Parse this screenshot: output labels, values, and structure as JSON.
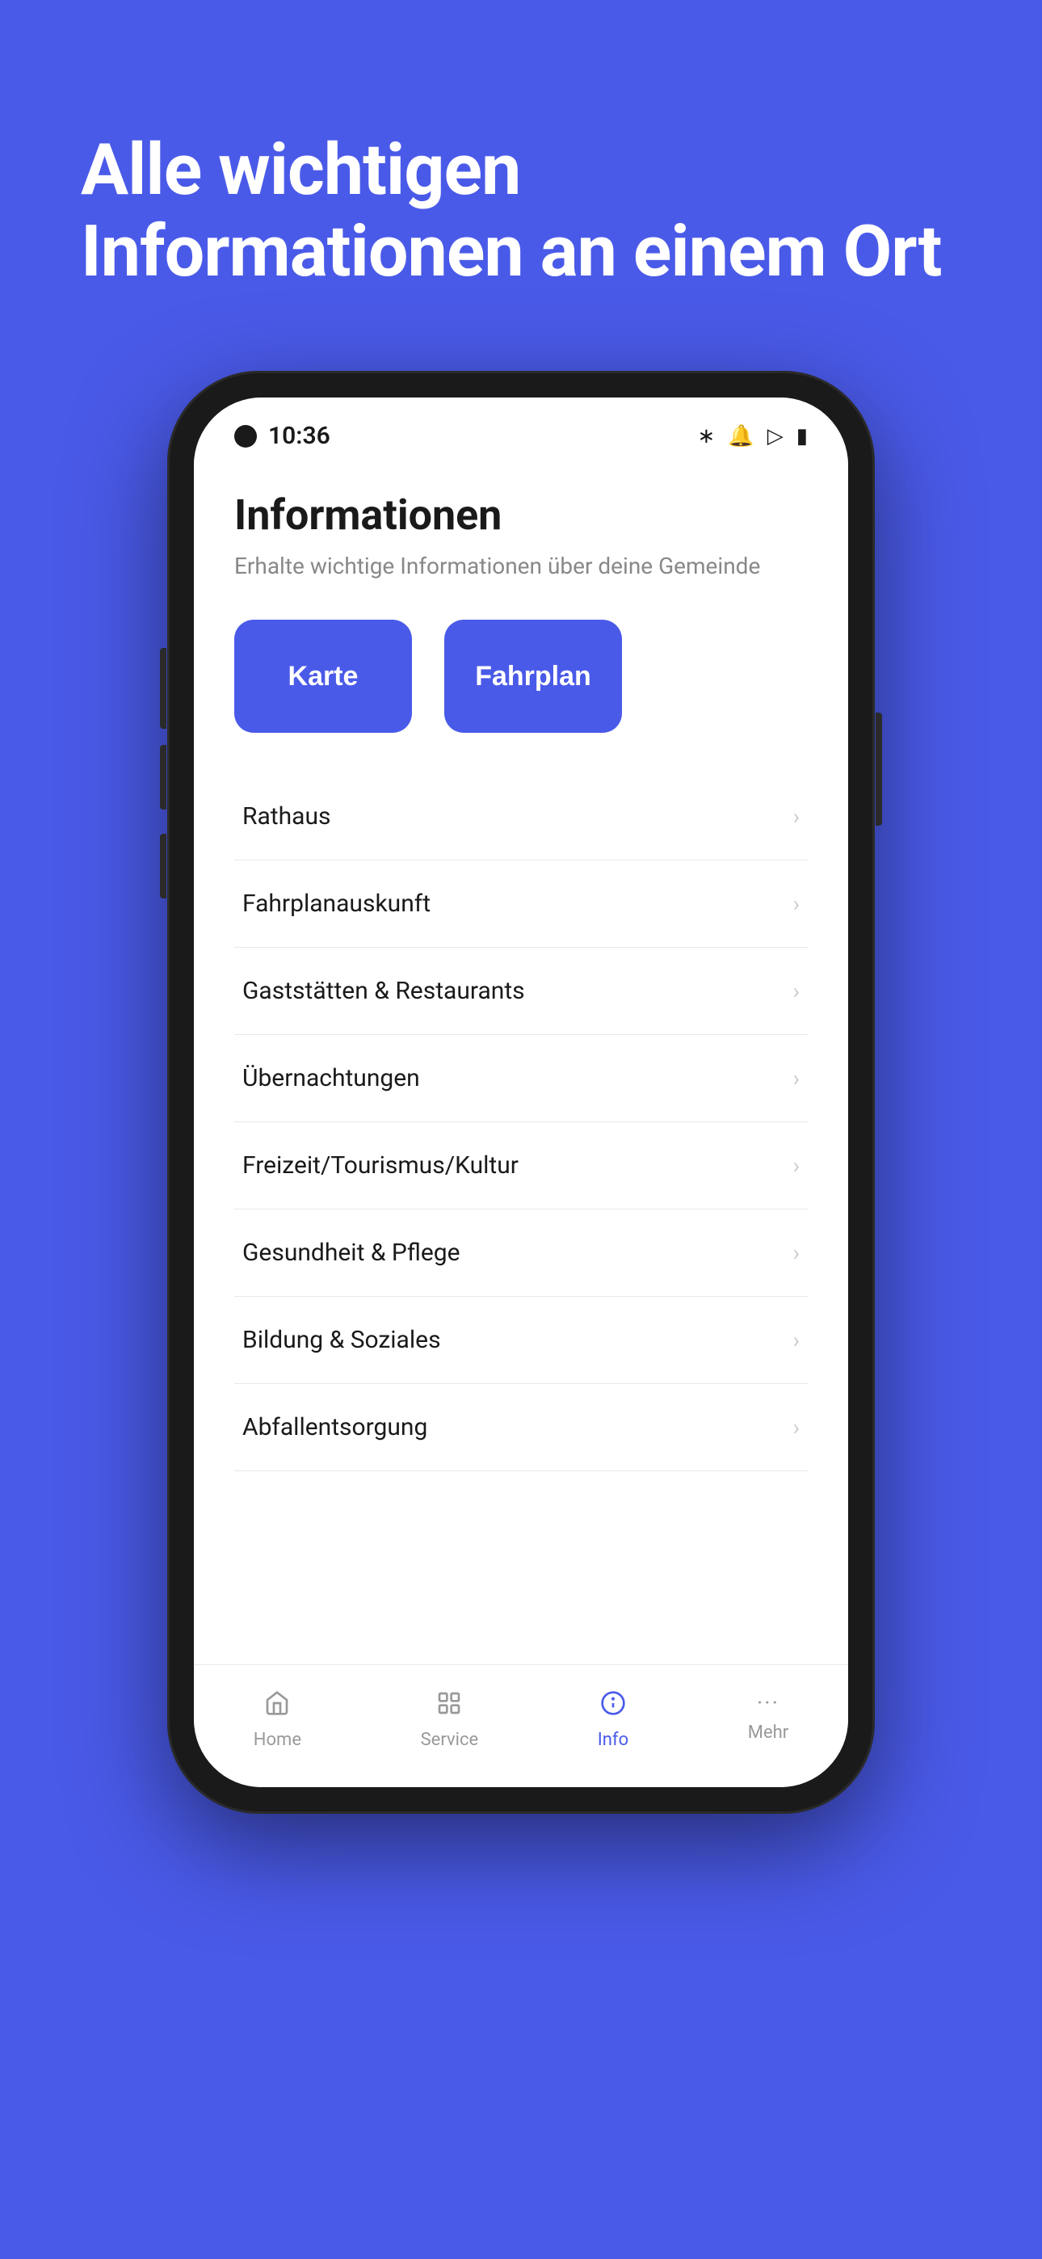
{
  "background_color": "#4A5AE8",
  "hero": {
    "title": "Alle wichtigen Informationen an einem Ort"
  },
  "phone": {
    "status_bar": {
      "time": "10:36",
      "icons": [
        "bluetooth",
        "bell-off",
        "wifi",
        "battery"
      ]
    },
    "screen": {
      "page_title": "Informationen",
      "page_subtitle": "Erhalte wichtige Informationen über deine Gemeinde",
      "quick_buttons": [
        {
          "label": "Karte"
        },
        {
          "label": "Fahrplan"
        }
      ],
      "menu_items": [
        {
          "label": "Rathaus"
        },
        {
          "label": "Fahrplanauskunft"
        },
        {
          "label": "Gaststätten & Restaurants"
        },
        {
          "label": "Übernachtungen"
        },
        {
          "label": "Freizeit/Tourismus/Kultur"
        },
        {
          "label": "Gesundheit & Pflege"
        },
        {
          "label": "Bildung & Soziales"
        },
        {
          "label": "Abfallentsorgung"
        }
      ],
      "bottom_nav": [
        {
          "label": "Home",
          "icon": "home",
          "active": false
        },
        {
          "label": "Service",
          "icon": "grid",
          "active": false
        },
        {
          "label": "Info",
          "icon": "info",
          "active": true
        },
        {
          "label": "Mehr",
          "icon": "dots",
          "active": false
        }
      ]
    }
  }
}
